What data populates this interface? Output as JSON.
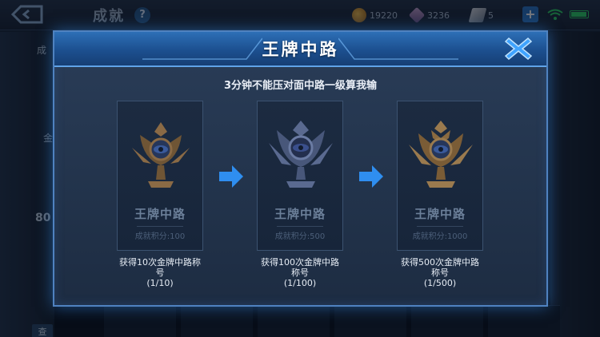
{
  "page": {
    "title": "成就",
    "help_symbol": "?",
    "resources": {
      "coins": "19220",
      "gems": "3236",
      "tickets": "5"
    },
    "left_panel": {
      "label_1": "成",
      "label_2": "金",
      "score_fragment": "80",
      "button_label": "查"
    }
  },
  "modal": {
    "title": "王牌中路",
    "subtitle": "3分钟不能压对面中路一级算我输",
    "stages": [
      {
        "name": "王牌中路",
        "score_label": "成就积分:100",
        "description_line1": "获得10次金牌中路称",
        "description_line2": "号",
        "progress": "(1/10)",
        "trophy_tier": "bronze"
      },
      {
        "name": "王牌中路",
        "score_label": "成就积分:500",
        "description_line1": "获得100次金牌中路",
        "description_line2": "称号",
        "progress": "(1/100)",
        "trophy_tier": "silver"
      },
      {
        "name": "王牌中路",
        "score_label": "成就积分:1000",
        "description_line1": "获得500次金牌中路",
        "description_line2": "称号",
        "progress": "(1/500)",
        "trophy_tier": "gold"
      }
    ]
  },
  "icons": {
    "back": "back-arrow-icon",
    "help": "question-icon",
    "close": "close-x-icon",
    "arrow": "right-arrow-icon",
    "wifi": "wifi-icon",
    "battery": "battery-icon"
  },
  "colors": {
    "accent_blue": "#2d78c9",
    "close_icon": "#3fa3ff",
    "trophy_bronze": "#8a6a45",
    "trophy_silver": "#5a6a90",
    "trophy_gold": "#9a7a4e",
    "battery": "#2fd26b"
  }
}
